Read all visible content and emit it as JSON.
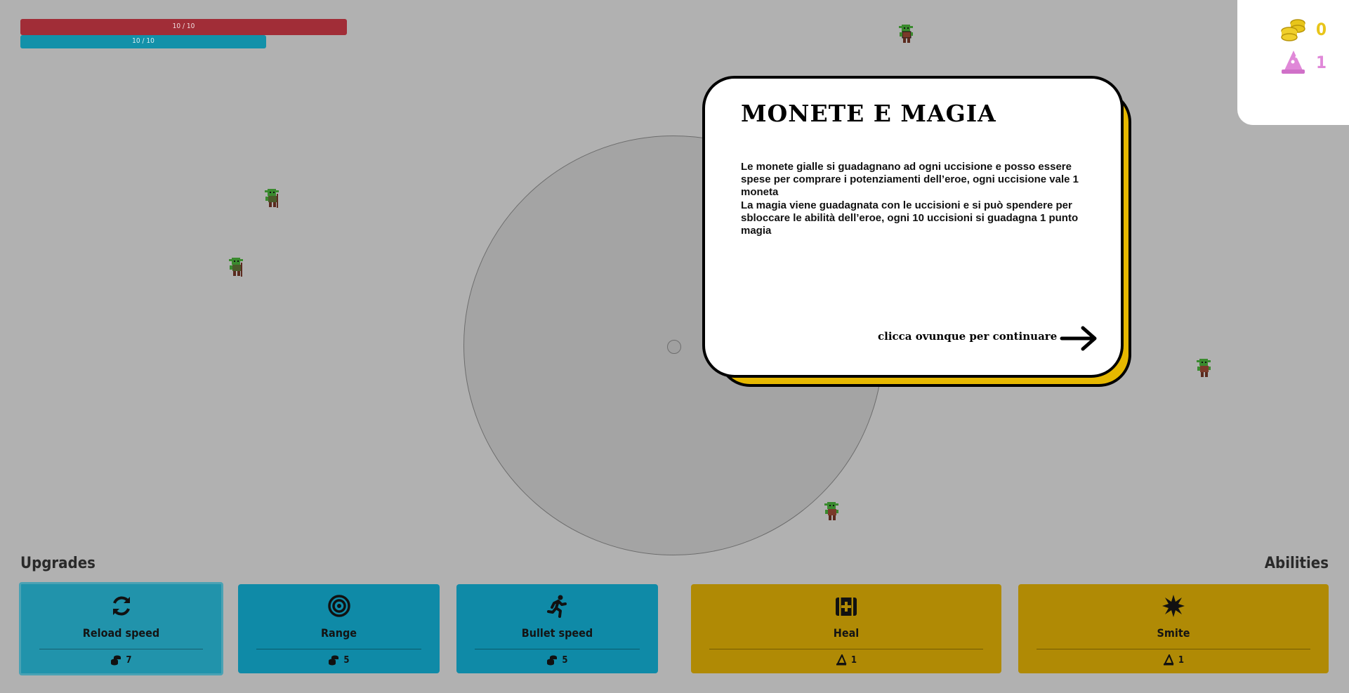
{
  "player": {
    "hp_text": "10 / 10",
    "mana_text": "10 / 10",
    "hp_fraction": 1.0,
    "mana_fraction": 1.0
  },
  "resources": {
    "coins": "0",
    "magic": "1",
    "coin_icon": "coins-icon",
    "magic_icon": "wizard-hat-icon"
  },
  "enemies": {
    "icon": "goblin-icon",
    "count": 5
  },
  "tutorial": {
    "title": "MONETE E MAGIA",
    "paragraph_1": "Le monete gialle si guadagnano ad ogni uccisione e posso essere spese per comprare i potenziamenti dell’eroe, ogni uccisione vale 1 moneta",
    "paragraph_2": "La magia viene guadagnata con le uccisioni e si può spendere per sbloccare le abilità dell’eroe, ogni 10 uccisioni si guadagna 1 punto magia",
    "continue_text": "clicca ovunque per continuare",
    "continue_icon": "arrow-right-icon"
  },
  "upgrades": {
    "title": "Upgrades",
    "items": [
      {
        "label": "Reload speed",
        "cost": "7",
        "icon": "refresh-icon"
      },
      {
        "label": "Range",
        "cost": "5",
        "icon": "target-icon"
      },
      {
        "label": "Bullet speed",
        "cost": "5",
        "icon": "running-icon"
      }
    ]
  },
  "abilities": {
    "title": "Abilities",
    "items": [
      {
        "label": "Heal",
        "cost": "1",
        "icon": "medkit-icon"
      },
      {
        "label": "Smite",
        "cost": "1",
        "icon": "burst-icon"
      }
    ]
  },
  "colors": {
    "background": "#b1b1b1",
    "hp": "#a12d37",
    "mana": "#1391a9",
    "upgrade_card": "#0f8aa7",
    "ability_card": "#b08a05",
    "modal_accent": "#e6b800"
  }
}
